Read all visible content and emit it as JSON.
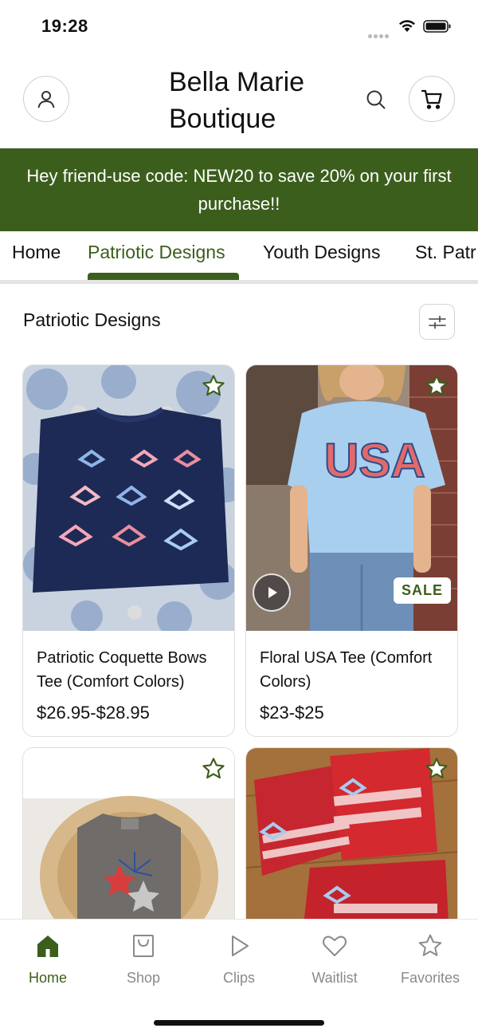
{
  "status_bar": {
    "time": "19:28"
  },
  "header": {
    "brand_line1": "Bella Marie",
    "brand_line2": "Boutique",
    "account_icon": "person-icon",
    "search_icon": "search-icon",
    "cart_icon": "cart-icon"
  },
  "promo": {
    "text": "Hey friend-use code: NEW20 to save 20% on your first purchase!!"
  },
  "tabs": [
    {
      "label": "Home"
    },
    {
      "label": "Patriotic Designs",
      "active": true
    },
    {
      "label": "Youth Designs"
    },
    {
      "label": "St. Patr"
    }
  ],
  "section": {
    "title": "Patriotic Designs",
    "filter_icon": "sliders-icon"
  },
  "products": [
    {
      "name": "Patriotic Coquette Bows Tee (Comfort Colors)",
      "price": "$26.95-$28.95"
    },
    {
      "name": "Floral USA Tee (Comfort Colors)",
      "price": "$23-$25",
      "badge": "SALE",
      "video": true
    },
    {
      "name": "",
      "price": ""
    },
    {
      "name": "",
      "price": ""
    }
  ],
  "bottom_nav": [
    {
      "label": "Home",
      "icon": "home-icon",
      "active": true
    },
    {
      "label": "Shop",
      "icon": "shopping-bag-icon"
    },
    {
      "label": "Clips",
      "icon": "play-icon"
    },
    {
      "label": "Waitlist",
      "icon": "heart-icon"
    },
    {
      "label": "Favorites",
      "icon": "star-icon"
    }
  ],
  "colors": {
    "accent": "#3c5e1c",
    "inactive": "#8a8a8a",
    "divider": "#e3e3e6"
  }
}
